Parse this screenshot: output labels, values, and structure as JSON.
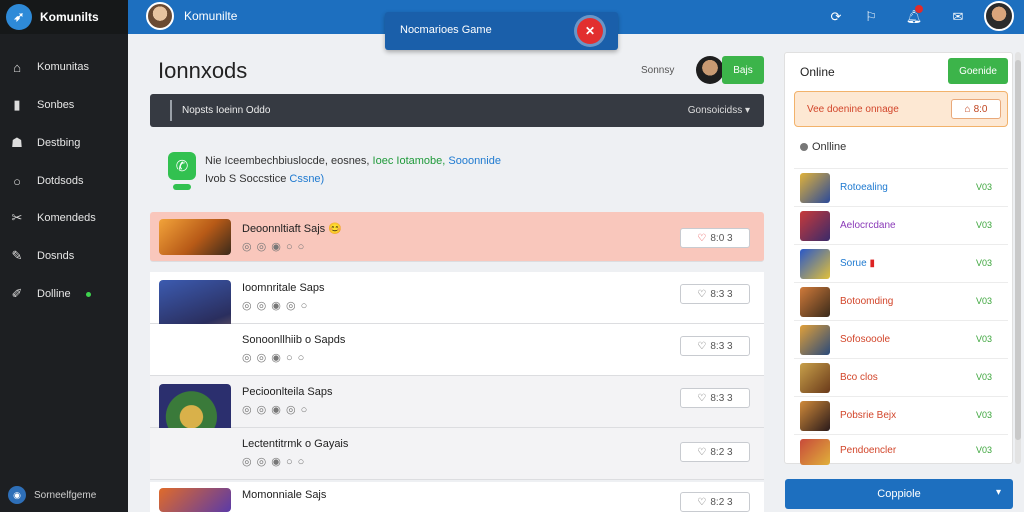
{
  "sidebar": {
    "brand": "Komunilts",
    "items": [
      {
        "label": "Komunitas",
        "icon": "home-icon"
      },
      {
        "label": "Sonbes",
        "icon": "bookmark-icon"
      },
      {
        "label": "Destbing",
        "icon": "users-icon"
      },
      {
        "label": "Dotdsods",
        "icon": "circle-icon"
      },
      {
        "label": "Komendeds",
        "icon": "tools-icon"
      },
      {
        "label": "Dosnds",
        "icon": "pen-icon"
      },
      {
        "label": "Dolline",
        "icon": "edit-icon"
      }
    ],
    "footer": "Sorneelfgeme"
  },
  "topbar": {
    "title": "Komunilte",
    "icons": [
      "refresh-icon",
      "chat-icon",
      "bell-icon",
      "message-icon"
    ]
  },
  "game_banner": {
    "text": "Nocmarioes Game"
  },
  "main": {
    "title": "Ionnxods",
    "sort_label": "Sonnsy",
    "join_label": "Bajs",
    "dark_bar": {
      "text": "Nopsts Ioeinn Oddo",
      "right": "Gonsoicidss ▾"
    },
    "info": {
      "line1_a": "Nie Iceembechbiuslocde, eosnes, ",
      "line1_b": "Ioec Iotamobe, ",
      "line1_c": "Sooonnide",
      "line2_a": "Ivob S Soccstice ",
      "line2_b": "Cssne)"
    },
    "rows": [
      {
        "title": "Deoonnltiaft Sajs 😊",
        "sub": "◎ ◎ ◉ ○ ○",
        "btn": "8:0 3"
      },
      {
        "title": "Ioomnritale Saps",
        "sub": "◎ ◎ ◉ ◎ ○",
        "btn": "8:3 3"
      },
      {
        "title": "Sonoonllhiib o Sapds",
        "sub": "◎ ◎ ◉ ○ ○",
        "btn": "8:3 3"
      },
      {
        "title": "Pecioonlteila Saps",
        "sub": "◎ ◎ ◉ ◎ ○",
        "btn": "8:3 3"
      },
      {
        "title": "Lectentitrmk o Gayais",
        "sub": "◎ ◎ ◉ ○ ○",
        "btn": "8:2 3"
      },
      {
        "title": "Momonniale Sajs",
        "sub": "◎ ◎ ◉ ○ ○",
        "btn": "8:2 3"
      }
    ]
  },
  "right_panel": {
    "title": "Online",
    "button": "Goenide",
    "promo_text": "Vee doenine onnage",
    "promo_btn": "8:0",
    "online_head": "Onlline",
    "users": [
      {
        "name": "Rotoealing",
        "status": "V03",
        "color": "#1f7ad0"
      },
      {
        "name": "Aelocrcdane",
        "status": "V03",
        "color": "#8a3ab8"
      },
      {
        "name": "Sorue",
        "status": "V03",
        "color": "#1f7ad0"
      },
      {
        "name": "Botoomding",
        "status": "V03",
        "color": "#d2452a"
      },
      {
        "name": "Sofosooole",
        "status": "V03",
        "color": "#d2452a"
      },
      {
        "name": "Bco clos",
        "status": "V03",
        "color": "#d2452a"
      },
      {
        "name": "Pobsrie Bejx",
        "status": "V03",
        "color": "#d2452a"
      },
      {
        "name": "Pendoencler",
        "status": "V03",
        "color": "#d2452a"
      }
    ]
  },
  "bottom_button": "Coppiole"
}
